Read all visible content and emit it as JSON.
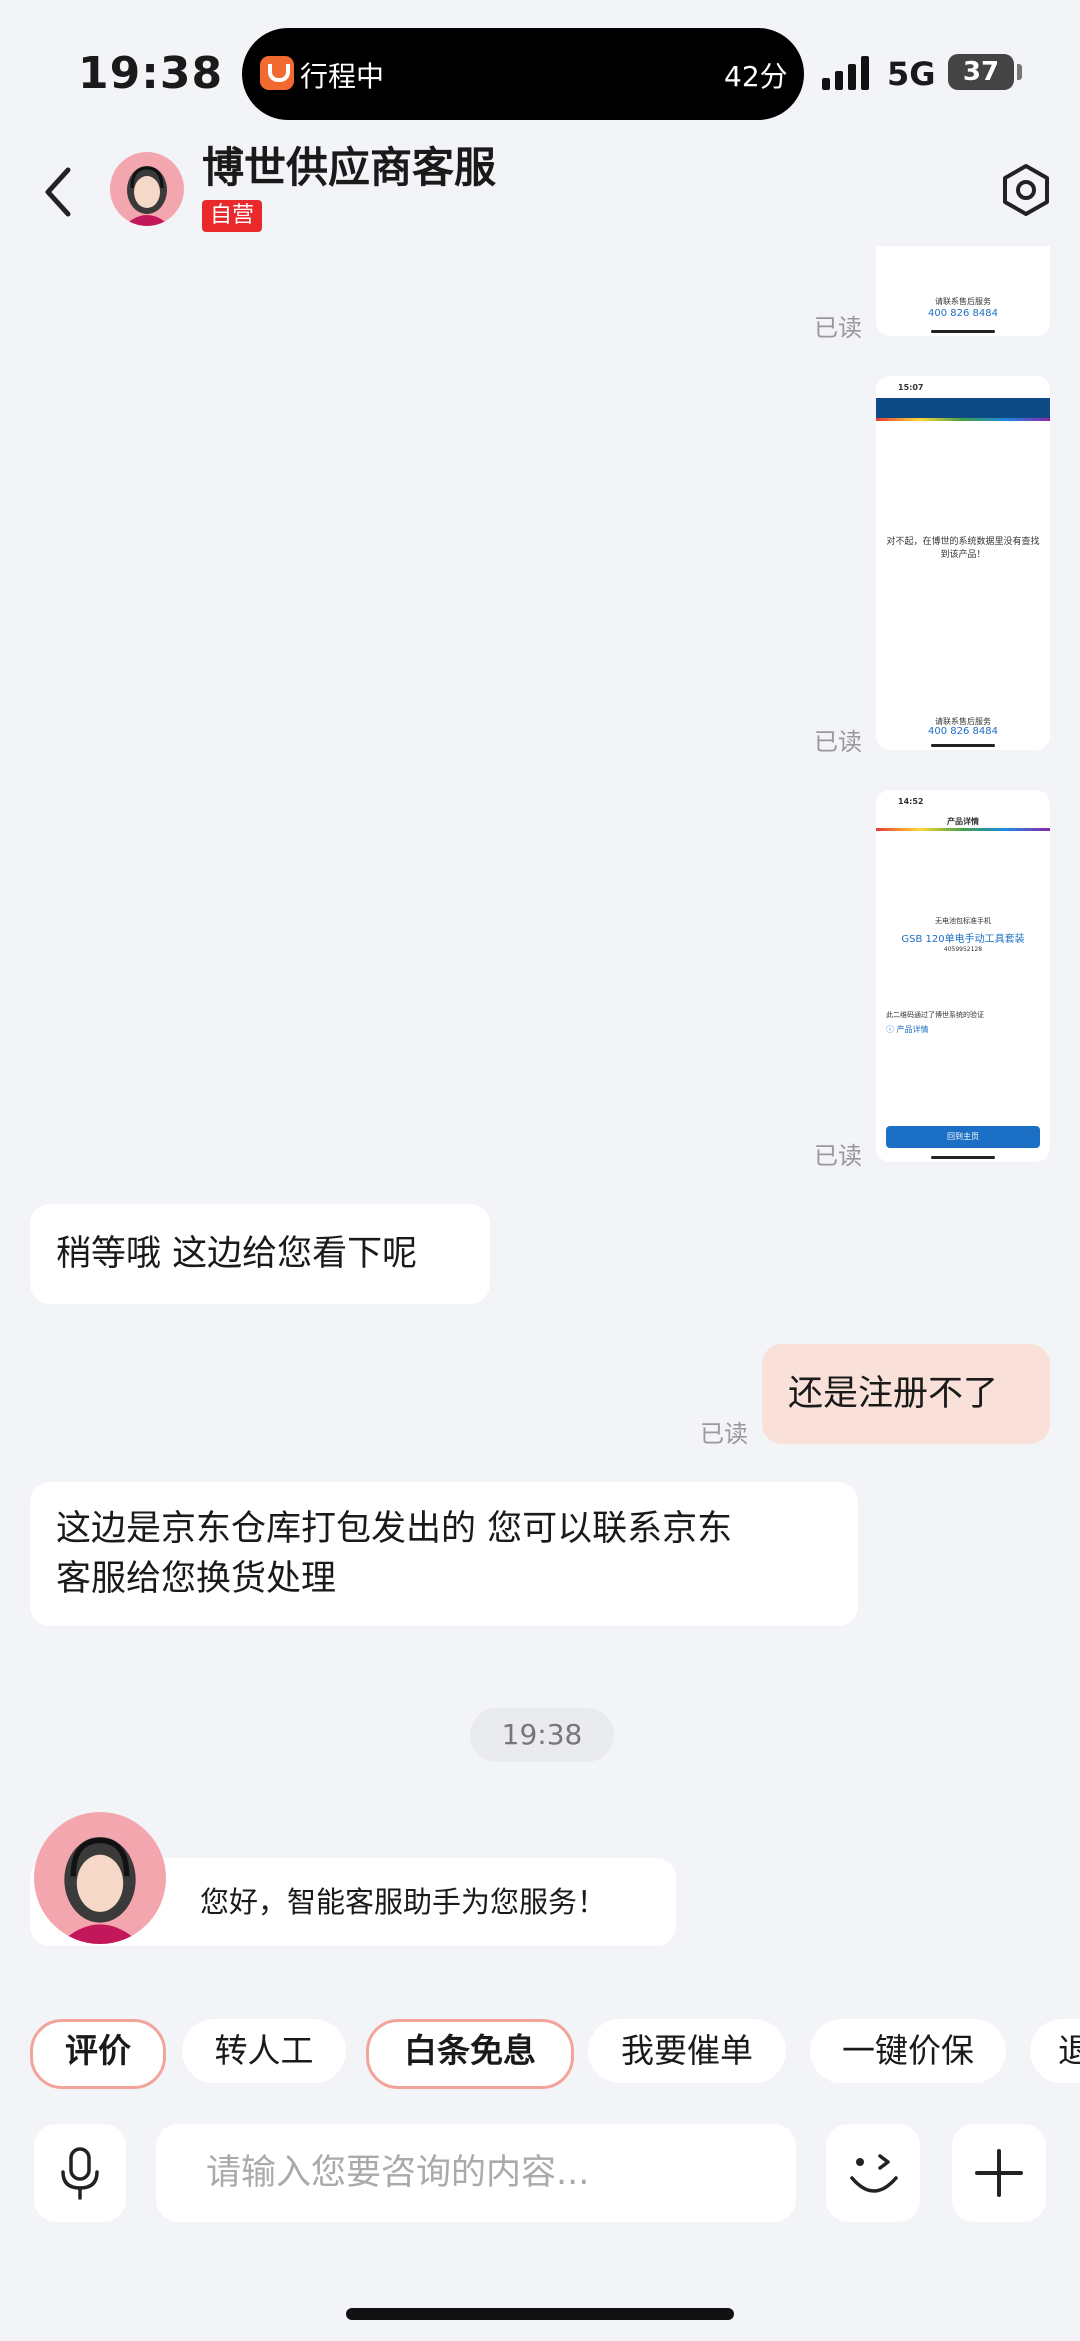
{
  "status_bar": {
    "time": "19:38",
    "island_text": "行程中",
    "island_minutes": "42分",
    "network": "5G",
    "battery": "37"
  },
  "header": {
    "title": "博世供应商客服",
    "tag": "自营"
  },
  "messages": {
    "read_label": "已读",
    "thumb1": {
      "phone": "400 826 8484",
      "small": "请联系售后服务"
    },
    "thumb2": {
      "time": "15:07",
      "body": "对不起，在博世的系统数据里没有查找到该产品！",
      "phone": "400 826 8484",
      "small": "请联系售后服务"
    },
    "thumb3": {
      "time": "14:52",
      "header": "产品详情",
      "brand": "无电池包标准手机",
      "product": "GSB 120单电手动工具套装",
      "code": "4059952128",
      "verify": "此二维码通过了博世系统的验证",
      "detail": "ⓘ 产品详情",
      "button": "回到主页"
    },
    "agent_1": "稍等哦 这边给您看下呢",
    "user_1": "还是注册不了",
    "agent_2_line1": "这边是京东仓库打包发出的  您可以联系京东",
    "agent_2_line2": "客服给您换货处理",
    "time_divider": "19:38",
    "bot_greeting": "您好，智能客服助手为您服务！"
  },
  "quick_actions": [
    "评价",
    "转人工",
    "白条免息",
    "我要催单",
    "一键价保",
    "退"
  ],
  "input": {
    "placeholder": "请输入您要咨询的内容..."
  },
  "icons": [
    "back-icon",
    "settings-icon",
    "mic-icon",
    "emoji-icon",
    "plus-icon",
    "signal-icon"
  ],
  "colors": {
    "background": "#F3F4F8",
    "self_tag": "#E9292C",
    "user_bubble": "#F9E1DA",
    "chip_highlight": "#F2A49A",
    "link_blue": "#1E6FC3"
  }
}
